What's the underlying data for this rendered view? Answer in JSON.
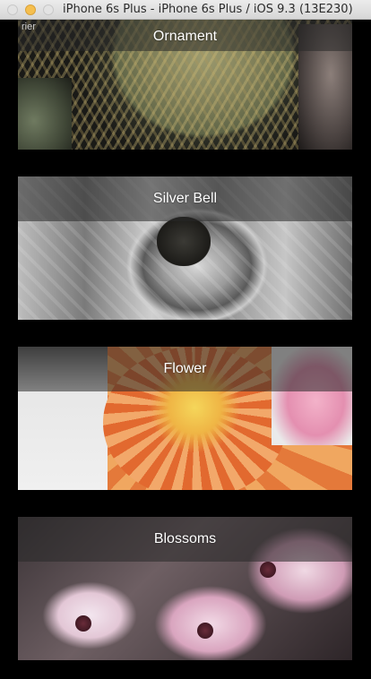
{
  "window": {
    "title": "iPhone 6s Plus - iPhone 6s Plus / iOS 9.3 (13E230)"
  },
  "status": {
    "carrier": "rier"
  },
  "cards": [
    {
      "label": "Ornament"
    },
    {
      "label": "Silver Bell"
    },
    {
      "label": "Flower"
    },
    {
      "label": "Blossoms"
    }
  ],
  "colors": {
    "background": "#000000",
    "label_bar": "rgba(40,40,40,0.55)",
    "label_text": "#ffffff"
  }
}
